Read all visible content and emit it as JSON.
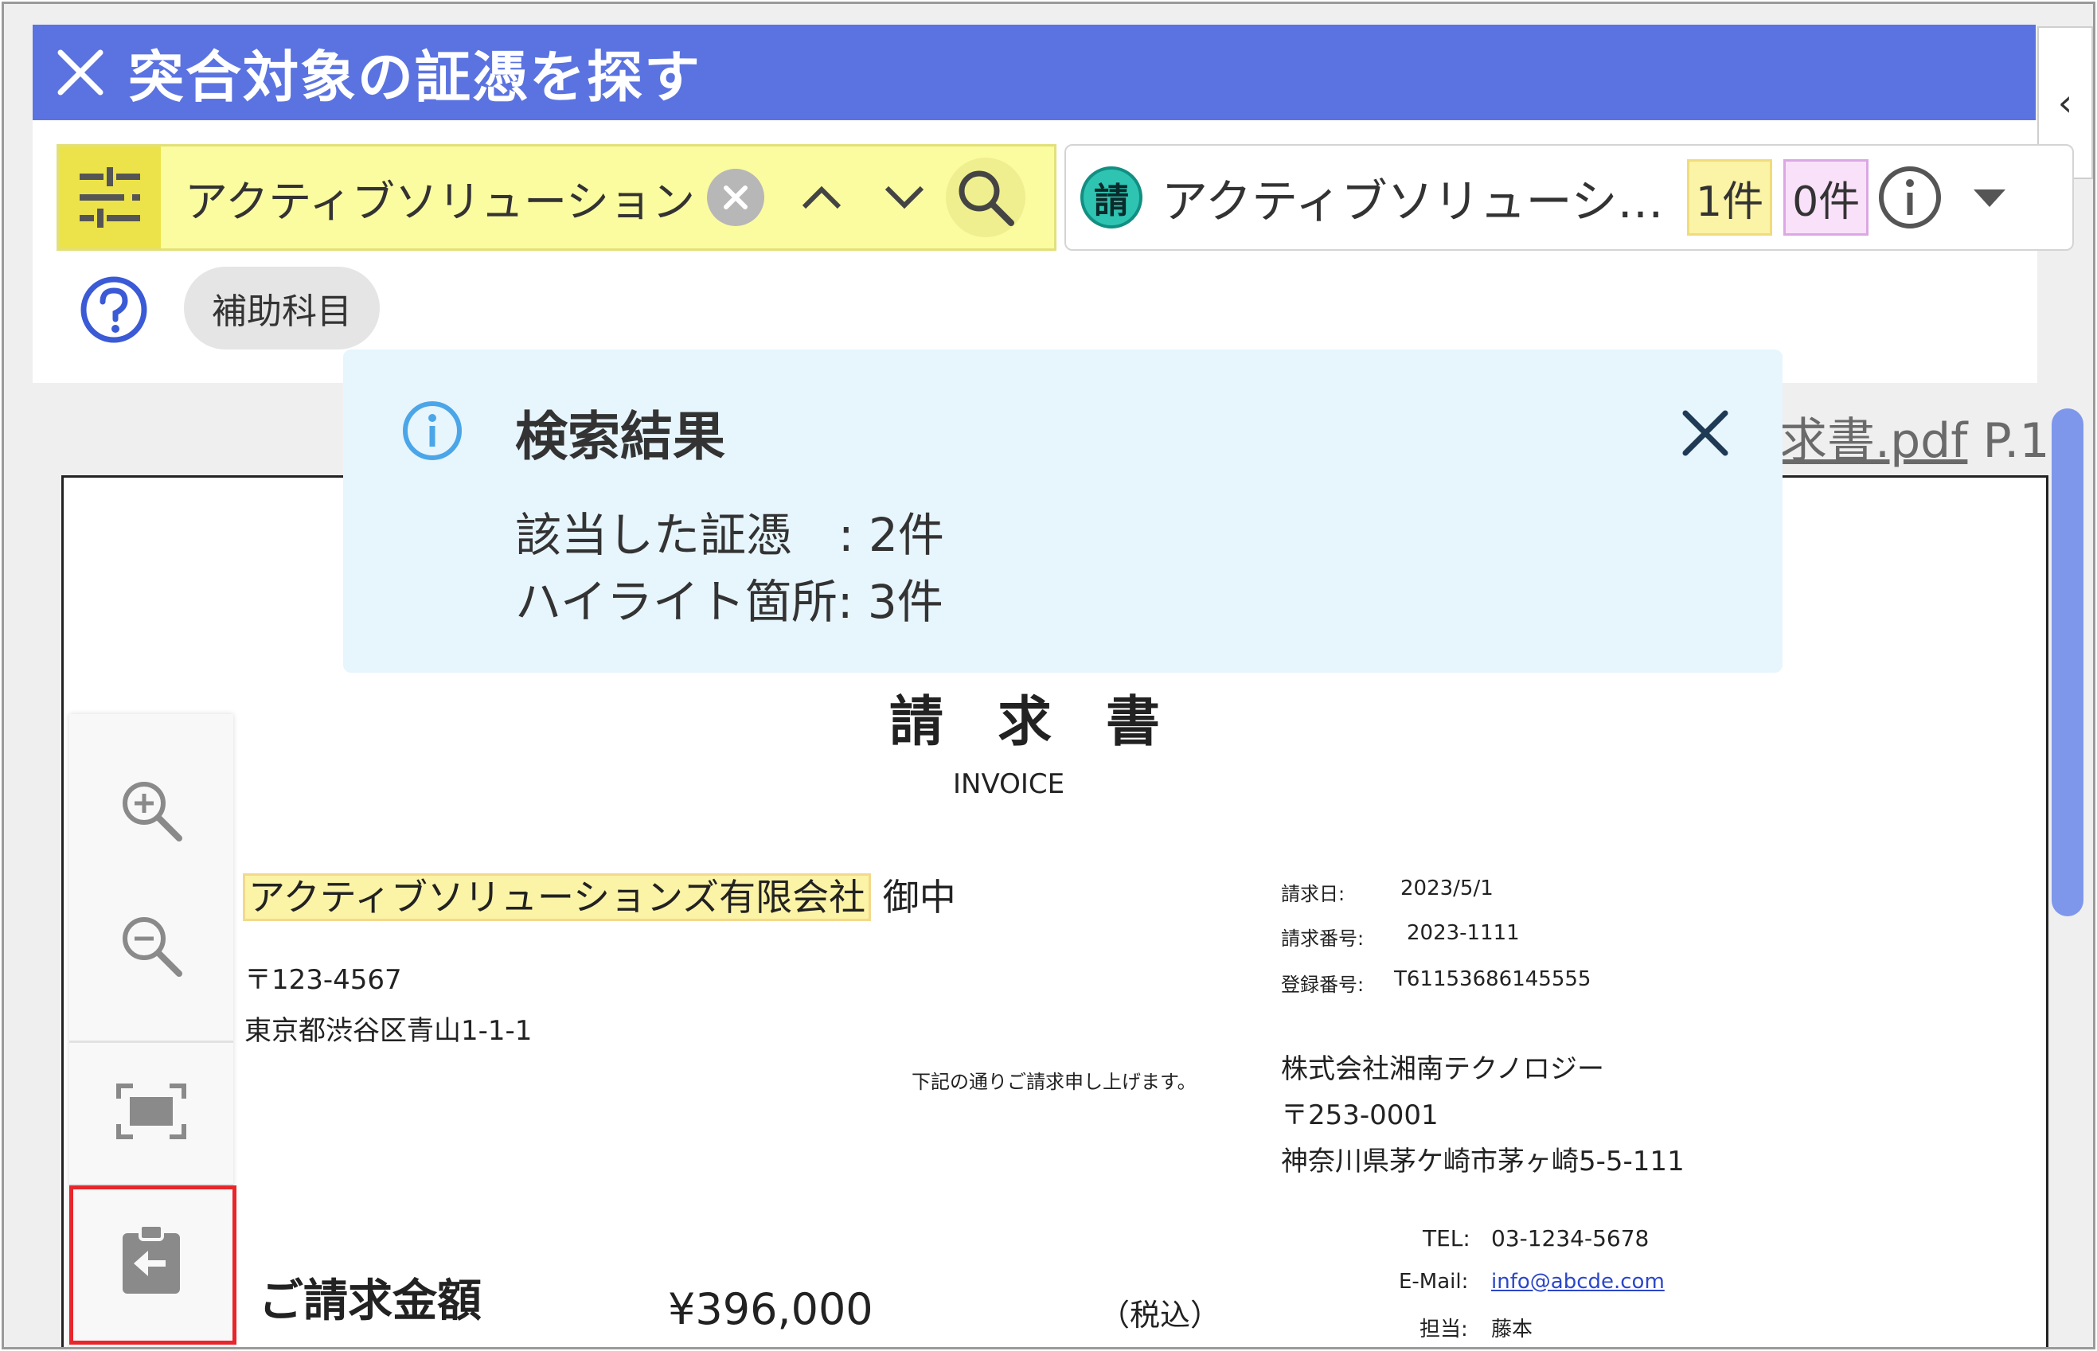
{
  "header": {
    "title": "突合対象の証憑を探す",
    "close_icon": "close-icon",
    "color": "#5b73e0"
  },
  "side_panel": {
    "collapse_glyph": "‹"
  },
  "search": {
    "query": "アクティブソリューションズ",
    "filter_icon": "tune-icon",
    "highlight_color": "#fbfba0"
  },
  "vendor": {
    "badge": "請",
    "name": "アクティブソリューシ…",
    "count_yellow": "1件",
    "count_pink": "0件"
  },
  "chip": {
    "label": "補助科目"
  },
  "file": {
    "name_visible": "求書.pdf",
    "page": "P.1"
  },
  "popup": {
    "title": "検索結果",
    "line1": "該当した証憑　: 2件",
    "line2": "ハイライト箇所: 3件"
  },
  "invoice": {
    "title": "請　求　書",
    "subtitle": "INVOICE",
    "recipient_company": "アクティブソリューションズ有限会社",
    "recipient_suffix": "御中",
    "recipient_postal": "〒123-4567",
    "recipient_address": "東京都渋谷区青山1-1-1",
    "note": "下記の通りご請求申し上げます。",
    "meta": [
      {
        "label": "請求日:",
        "value": "2023/5/1"
      },
      {
        "label": "請求番号:",
        "value": "2023-1111"
      },
      {
        "label": "登録番号:",
        "value": "T61153686145555"
      }
    ],
    "issuer_name": "株式会社湘南テクノロジー",
    "issuer_postal": "〒253-0001",
    "issuer_address": "神奈川県茅ケ崎市茅ヶ崎5-5-111",
    "tel_label": "TEL:",
    "tel": "03-1234-5678",
    "email_label": "E-Mail:",
    "email": "info@abcde.com",
    "person_label": "担当:",
    "person": "藤本",
    "amount_label": "ご請求金額",
    "amount": "¥396,000",
    "tax_note": "（税込）"
  }
}
